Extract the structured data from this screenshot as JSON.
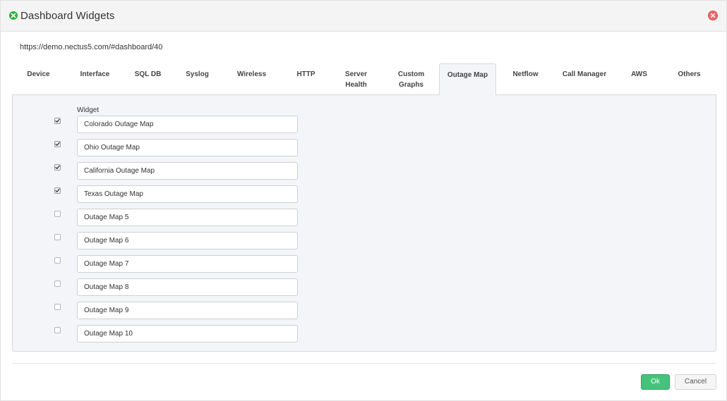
{
  "dialog": {
    "title": "Dashboard Widgets",
    "url": "https://demo.nectus5.com/#dashboard/40"
  },
  "tabs": [
    {
      "label": "Device",
      "active": false
    },
    {
      "label": "Interface",
      "active": false
    },
    {
      "label": "SQL DB",
      "active": false
    },
    {
      "label": "Syslog",
      "active": false
    },
    {
      "label": "Wireless",
      "active": false
    },
    {
      "label": "HTTP",
      "active": false
    },
    {
      "label": "Server Health",
      "active": false
    },
    {
      "label": "Custom Graphs",
      "active": false
    },
    {
      "label": "Outage Map",
      "active": true
    },
    {
      "label": "Netflow",
      "active": false
    },
    {
      "label": "Call Manager",
      "active": false
    },
    {
      "label": "AWS",
      "active": false
    },
    {
      "label": "Others",
      "active": false
    }
  ],
  "panel": {
    "column_header": "Widget",
    "widgets": [
      {
        "name": "Colorado Outage Map",
        "checked": true
      },
      {
        "name": "Ohio Outage Map",
        "checked": true
      },
      {
        "name": "California Outage Map",
        "checked": true
      },
      {
        "name": "Texas Outage Map",
        "checked": true
      },
      {
        "name": "Outage Map 5",
        "checked": false
      },
      {
        "name": "Outage Map 6",
        "checked": false
      },
      {
        "name": "Outage Map 7",
        "checked": false
      },
      {
        "name": "Outage Map 8",
        "checked": false
      },
      {
        "name": "Outage Map 9",
        "checked": false
      },
      {
        "name": "Outage Map 10",
        "checked": false
      }
    ]
  },
  "footer": {
    "ok_label": "Ok",
    "cancel_label": "Cancel"
  },
  "colors": {
    "ok_button": "#46c37b",
    "title_icon": "#27b33a",
    "close_icon": "#e66b6b",
    "panel_bg": "#f4f5f9"
  },
  "icons": {
    "title": "check-circle-icon",
    "close": "close-circle-icon",
    "checkbox_checked": "checkmark-icon"
  }
}
